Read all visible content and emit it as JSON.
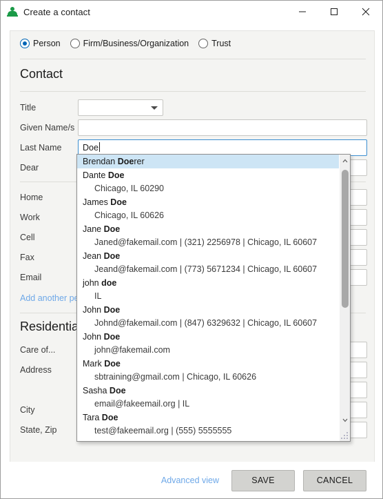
{
  "window": {
    "title": "Create a contact",
    "icon": "person-icon",
    "controls": {
      "minimize": "minimize-icon",
      "maximize": "maximize-icon",
      "close": "close-icon"
    }
  },
  "contact_type": {
    "options": [
      {
        "label": "Person",
        "checked": true
      },
      {
        "label": "Firm/Business/Organization",
        "checked": false
      },
      {
        "label": "Trust",
        "checked": false
      }
    ]
  },
  "sections": {
    "contact": {
      "title": "Contact",
      "fields": {
        "title": {
          "label": "Title",
          "value": "",
          "type": "combobox"
        },
        "given_names": {
          "label": "Given Name/s",
          "value": ""
        },
        "last_name": {
          "label": "Last Name",
          "value": "Doe",
          "focused": true
        },
        "dear": {
          "label": "Dear",
          "value": ""
        }
      },
      "contact_methods": [
        {
          "label": "Home",
          "value": ""
        },
        {
          "label": "Work",
          "value": ""
        },
        {
          "label": "Cell",
          "value": ""
        },
        {
          "label": "Fax",
          "value": ""
        },
        {
          "label": "Email",
          "value": ""
        }
      ],
      "add_link": "Add another per"
    },
    "residential": {
      "title": "Residential",
      "fields": [
        {
          "label": "Care of...",
          "value": ""
        },
        {
          "label": "Address",
          "value": ""
        },
        {
          "label": "City",
          "value": ""
        },
        {
          "label": "State, Zip",
          "value": ""
        }
      ]
    }
  },
  "autocomplete": {
    "visible": true,
    "items": [
      {
        "name_prefix": "Brendan ",
        "name_bold": "Doe",
        "name_suffix": "rer",
        "sub": "",
        "selected": true
      },
      {
        "name_prefix": "Dante ",
        "name_bold": "Doe",
        "name_suffix": "",
        "sub": "Chicago, IL 60290",
        "selected": false
      },
      {
        "name_prefix": "James ",
        "name_bold": "Doe",
        "name_suffix": "",
        "sub": "Chicago, IL 60626",
        "selected": false
      },
      {
        "name_prefix": "Jane ",
        "name_bold": "Doe",
        "name_suffix": "",
        "sub": "Janed@fakemail.com | (321) 2256978 | Chicago, IL 60607",
        "selected": false
      },
      {
        "name_prefix": "Jean ",
        "name_bold": "Doe",
        "name_suffix": "",
        "sub": "Jeand@fakemail.com | (773) 5671234 | Chicago, IL 60607",
        "selected": false
      },
      {
        "name_prefix": "john ",
        "name_bold": "doe",
        "name_suffix": "",
        "sub": "IL",
        "selected": false
      },
      {
        "name_prefix": "John ",
        "name_bold": "Doe",
        "name_suffix": "",
        "sub": "Johnd@fakemail.com | (847) 6329632 | Chicago, IL 60607",
        "selected": false
      },
      {
        "name_prefix": "John ",
        "name_bold": "Doe",
        "name_suffix": "",
        "sub": "john@fakemail.com",
        "selected": false
      },
      {
        "name_prefix": "Mark ",
        "name_bold": "Doe",
        "name_suffix": "",
        "sub": "sbtraining@gmail.com | Chicago, IL 60626",
        "selected": false
      },
      {
        "name_prefix": "Sasha ",
        "name_bold": "Doe",
        "name_suffix": "",
        "sub": "email@fakeemail.org | IL",
        "selected": false
      },
      {
        "name_prefix": "Tara ",
        "name_bold": "Doe",
        "name_suffix": "",
        "sub": "test@fakeemail.org | (555) 5555555",
        "selected": false
      }
    ]
  },
  "footer": {
    "advanced_view": "Advanced view",
    "save": "SAVE",
    "cancel": "CANCEL"
  },
  "colors": {
    "accent": "#0065b5",
    "link": "#6ea8e8",
    "selection": "#cde5f5",
    "panel_bg": "#f4f4f2",
    "icon_green": "#1a9a47"
  }
}
